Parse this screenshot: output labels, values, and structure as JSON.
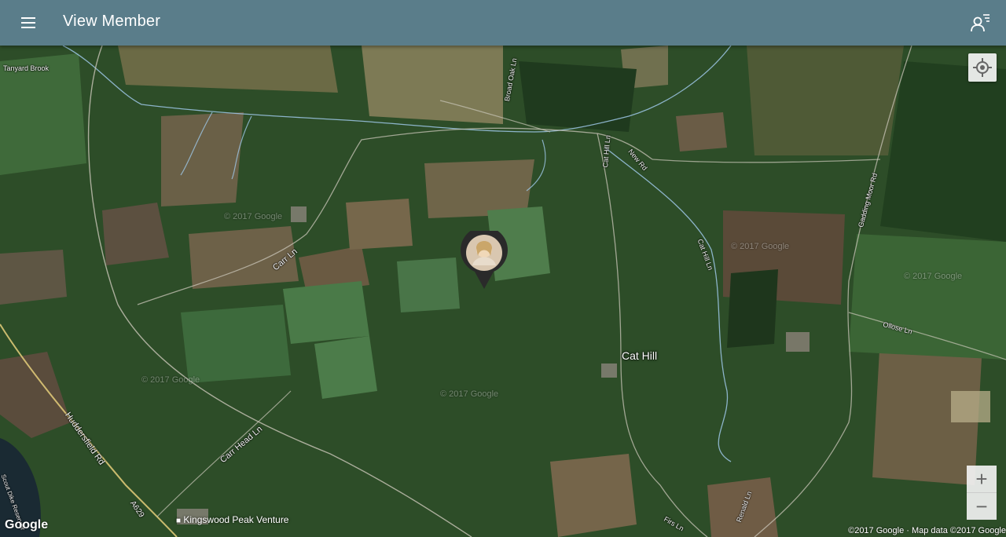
{
  "app_bar": {
    "title": "View Member",
    "menu_icon": "menu-icon",
    "member_list_icon": "member-list-icon",
    "color": "#5a7d8a"
  },
  "map": {
    "type": "satellite",
    "place_label": "Cat Hill",
    "poi_label": "Kingswood Peak Venture",
    "road_labels": {
      "tanyard_brook": "Tanyard Brook",
      "broad_oak_ln": "Broad Oak Ln",
      "cat_hill_ln_north": "Cat Hill Ln",
      "new_rd": "New Rd",
      "carr_ln": "Carr Ln",
      "cat_hill_ln_east": "Cat Hill Ln",
      "gadding_moor_rd": "Gadding Moor Rd",
      "ollose_ln": "Ollose Ln",
      "huddersfield_rd": "Huddersfield Rd",
      "carr_head_ln": "Carr Head Ln",
      "a629": "A629",
      "scout_dike_reservoir": "Scout Dike Reservoir",
      "firs_ln": "Firs Ln",
      "renald_ln": "Renald Ln"
    },
    "watermarks": [
      "© 2017 Google",
      "© 2017 Google",
      "© 2017 Google",
      "© 2017 Google",
      "© 2017 Google"
    ],
    "member_pin": {
      "icon": "member-avatar-pin-icon"
    },
    "controls": {
      "locate_icon": "my-location-icon",
      "zoom_in": "+",
      "zoom_out": "−"
    },
    "google_logo": "Google",
    "attribution": "©2017 Google · Map data ©2017 Google"
  }
}
